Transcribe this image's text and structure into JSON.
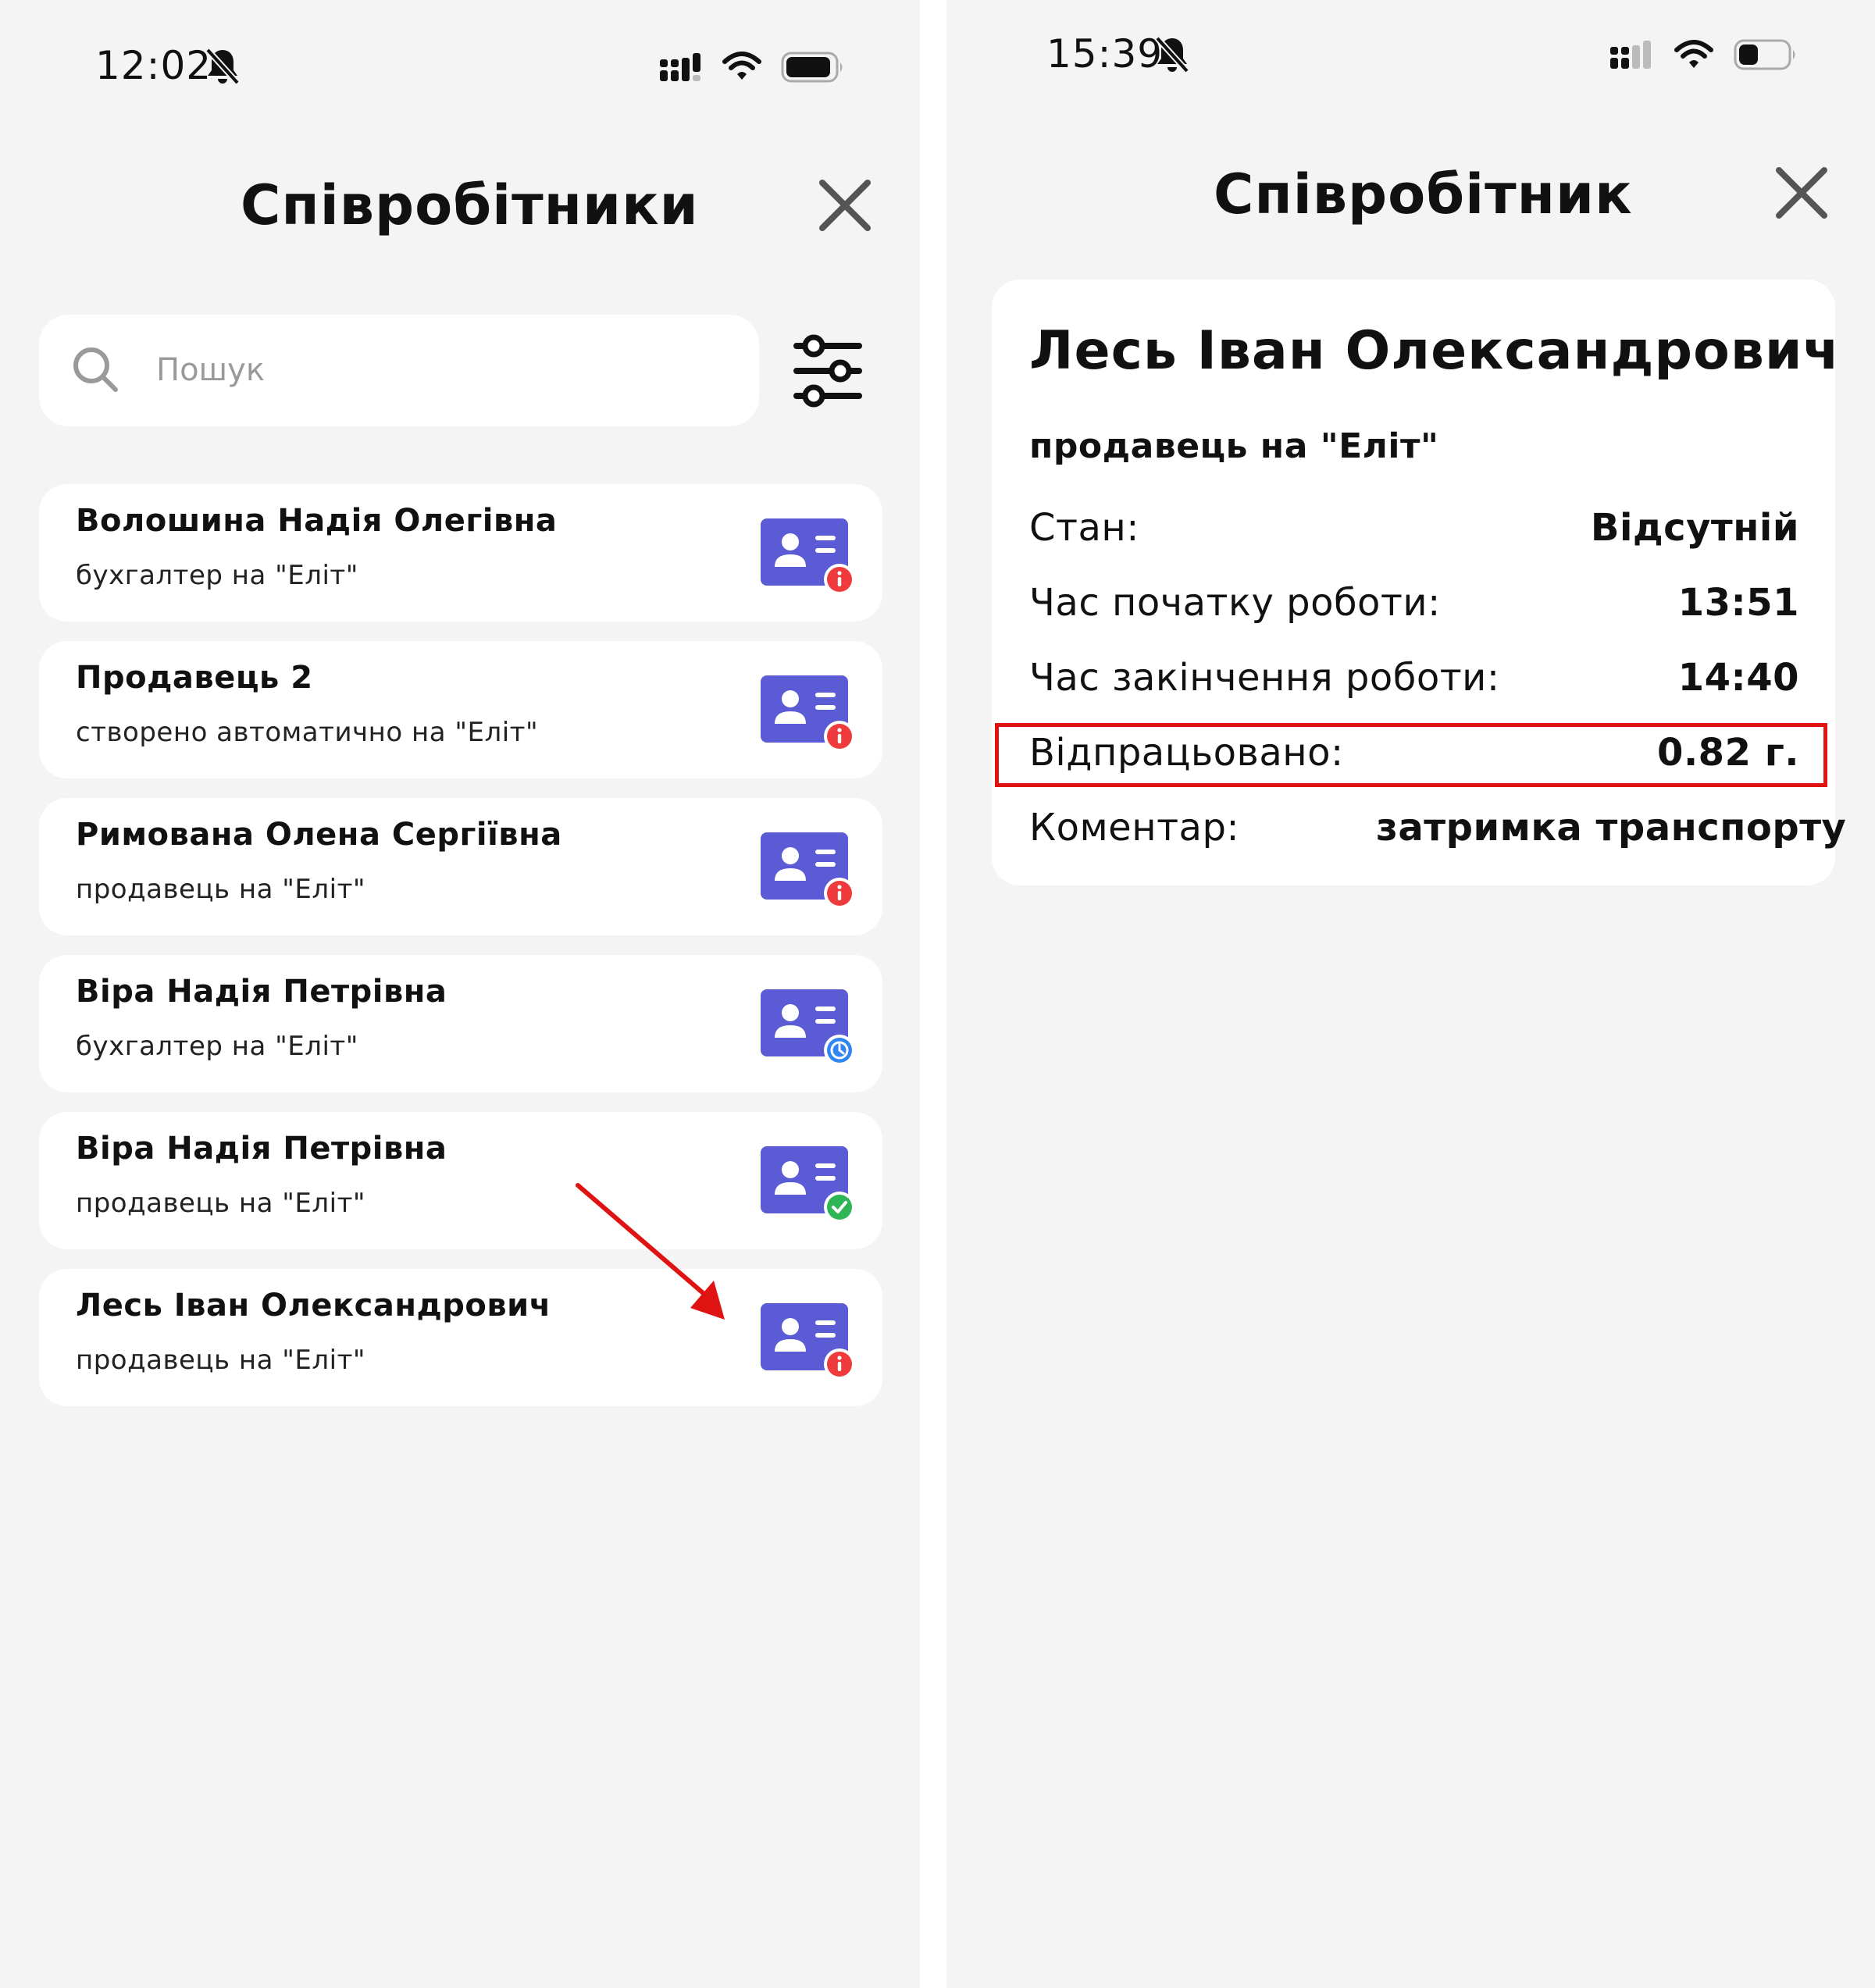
{
  "left": {
    "status_time": "12:02",
    "title": "Співробітники",
    "search": {
      "placeholder": "Пошук"
    },
    "employees": [
      {
        "name": "Волошина Надія Олегівна",
        "role": "бухгалтер на \"Еліт\"",
        "status": "info",
        "badge_color": "#ef3b3b"
      },
      {
        "name": "Продавець 2",
        "role": "створено автоматично на \"Еліт\"",
        "status": "info",
        "badge_color": "#ef3b3b"
      },
      {
        "name": "Римована Олена Сергіївна",
        "role": "продавець на \"Еліт\"",
        "status": "info",
        "badge_color": "#ef3b3b"
      },
      {
        "name": "Віра Надія Петрівна",
        "role": "бухгалтер на \"Еліт\"",
        "status": "clock",
        "badge_color": "#2f86f0"
      },
      {
        "name": "Віра Надія Петрівна",
        "role": "продавець на \"Еліт\"",
        "status": "check",
        "badge_color": "#2fb456"
      },
      {
        "name": "Лесь Іван Олександрович",
        "role": "продавець на \"Еліт\"",
        "status": "info",
        "badge_color": "#ef3b3b"
      }
    ]
  },
  "right": {
    "status_time": "15:39",
    "title": "Співробітник",
    "employee": {
      "name": "Лесь Іван Олександрович",
      "role": "продавець на \"Еліт\"",
      "state_label": "Стан:",
      "state_value": "Відсутній",
      "start_label": "Час початку роботи:",
      "start_value": "13:51",
      "end_label": "Час закінчення роботи:",
      "end_value": "14:40",
      "worked_label": "Відпрацьовано:",
      "worked_value": "0.82 г.",
      "comment_label": "Коментар:",
      "comment_value": "затримка транспорту"
    }
  },
  "colors": {
    "background": "#f4f4f4",
    "card": "#ffffff",
    "card_icon": "#5b5bd6",
    "highlight": "#e01313",
    "arrow": "#e01313"
  },
  "icons": [
    "bell-slash-icon",
    "signal-icon",
    "wifi-icon",
    "battery-icon",
    "close-icon",
    "search-icon",
    "filter-icon",
    "contact-card-icon",
    "info-badge-icon",
    "clock-badge-icon",
    "check-badge-icon"
  ]
}
